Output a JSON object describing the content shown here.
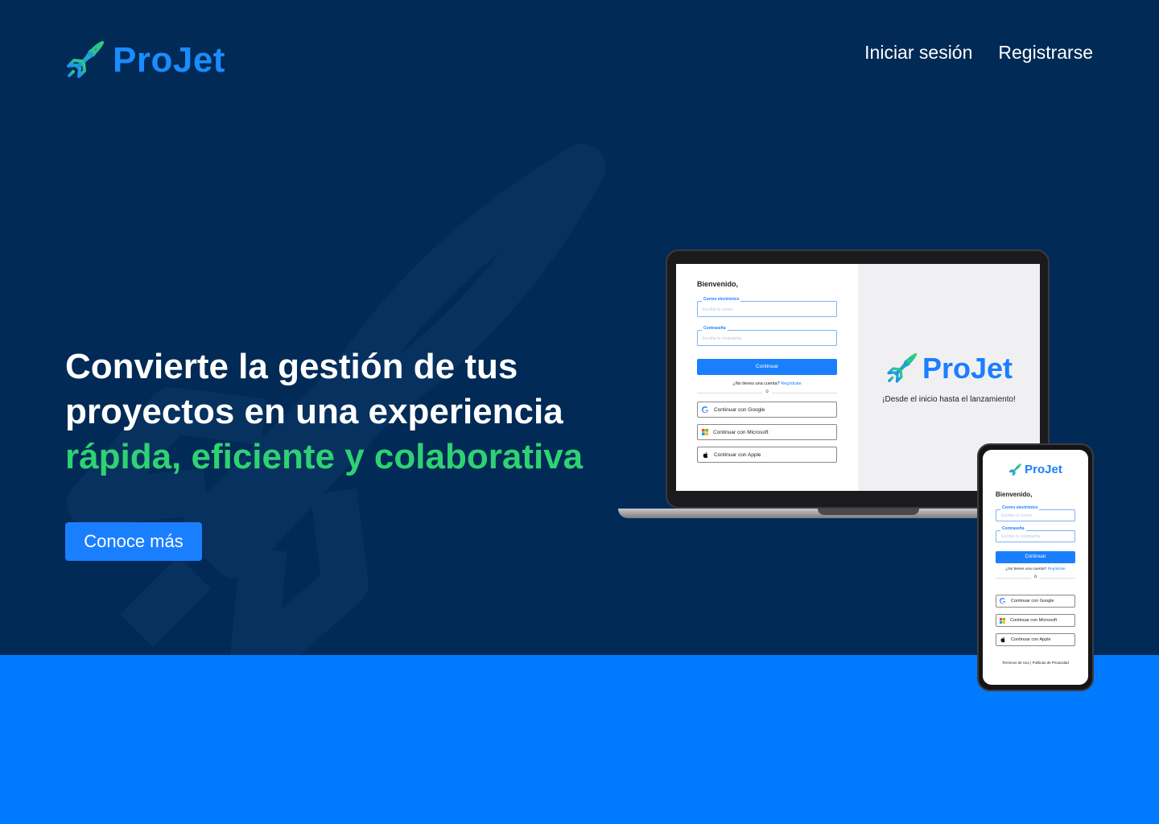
{
  "brand": {
    "name": "ProJet"
  },
  "nav": {
    "login": "Iniciar sesión",
    "register": "Registrarse"
  },
  "hero": {
    "line1": "Convierte la gestión de tus",
    "line2": "proyectos en una experiencia",
    "line3": "rápida, eficiente y colaborativa",
    "cta": "Conoce más"
  },
  "mockup": {
    "welcome": "Bienvenido,",
    "email_label": "Correo electrónico",
    "email_placeholder": "Escribe tu correo",
    "password_label": "Contraseña",
    "password_placeholder": "Escribe tu contraseña",
    "continue": "Continuar",
    "no_account": "¿No tienes una cuenta?",
    "register_link": "Regístrate",
    "or": "o",
    "google": "Continuar con Google",
    "microsoft": "Continuar con Microsoft",
    "apple": "Continuar con Apple",
    "tagline": "¡Desde el inicio hasta el lanzamiento!",
    "footer": "Terminos de Uso | Politicas de Privacidad"
  },
  "colors": {
    "hero_bg": "#022a56",
    "accent_blue": "#1a7fff",
    "accent_green": "#2ed273",
    "band_blue": "#007aff"
  },
  "icons": [
    "rocket-icon",
    "google-icon",
    "microsoft-icon",
    "apple-icon"
  ]
}
